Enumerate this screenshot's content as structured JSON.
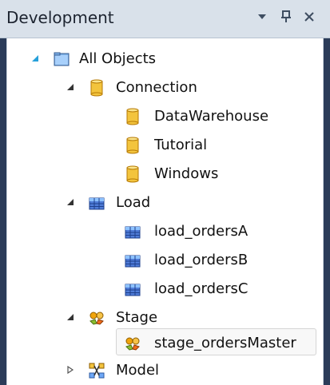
{
  "panel": {
    "title": "Development",
    "buttons": {
      "dropdown": "▼",
      "pin": "ㅁ",
      "close": "×"
    }
  },
  "tree": {
    "items": [
      {
        "label": "All Objects"
      },
      {
        "label": "Connection"
      },
      {
        "label": "DataWarehouse"
      },
      {
        "label": "Tutorial"
      },
      {
        "label": "Windows"
      },
      {
        "label": "Load"
      },
      {
        "label": "load_ordersA"
      },
      {
        "label": "load_ordersB"
      },
      {
        "label": "load_ordersC"
      },
      {
        "label": "Stage"
      },
      {
        "label": "stage_ordersMaster"
      },
      {
        "label": "Model"
      }
    ]
  },
  "colors": {
    "panel_background": "#2b3c59",
    "titlebar": "#d9e1ea",
    "tree_background": "#ffffff",
    "selection_border": "#d5d5d5"
  }
}
